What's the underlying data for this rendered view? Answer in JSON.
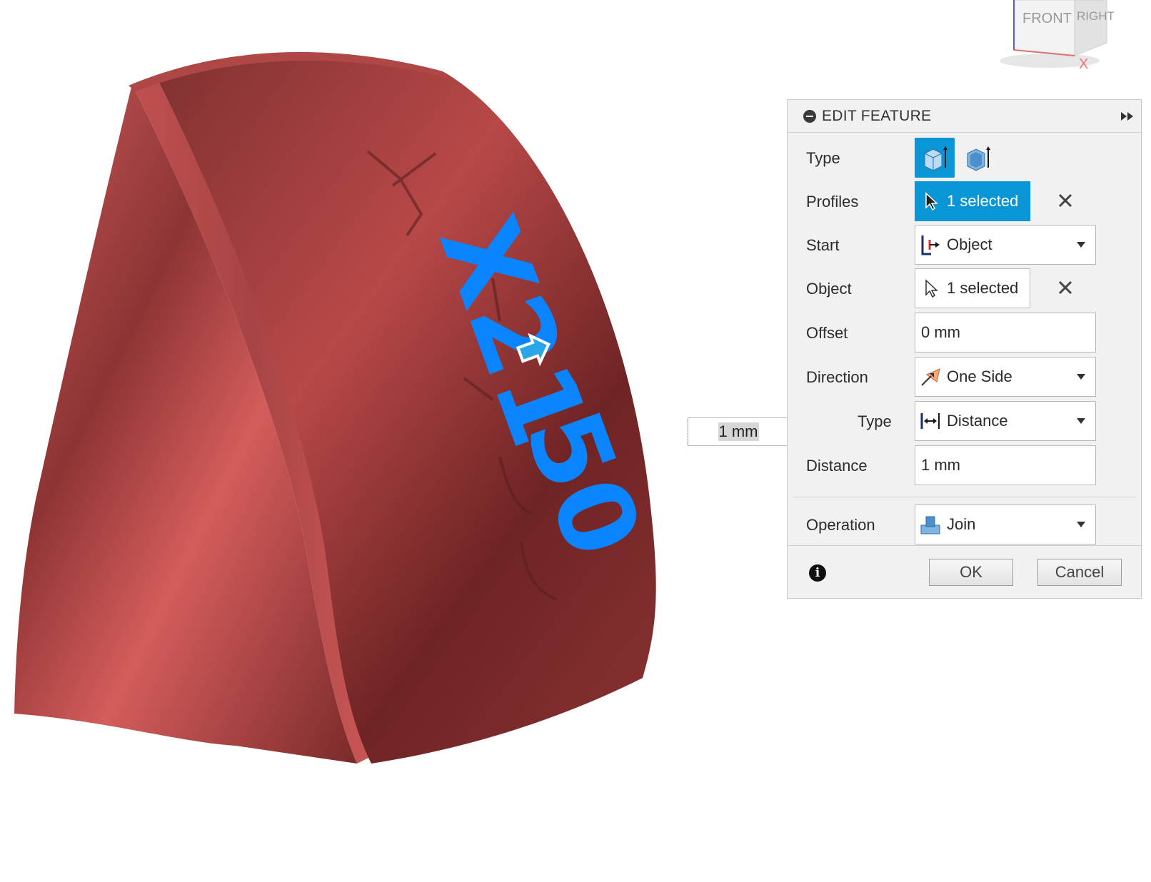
{
  "view_cube": {
    "front": "FRONT",
    "right": "RIGHT",
    "axis": "X"
  },
  "model_text": "X21 50",
  "inline_input": {
    "value": "1 mm"
  },
  "dialog": {
    "title": "EDIT FEATURE",
    "rows": {
      "type": {
        "label": "Type"
      },
      "profiles": {
        "label": "Profiles",
        "value": "1 selected"
      },
      "start": {
        "label": "Start",
        "value": "Object"
      },
      "object": {
        "label": "Object",
        "value": "1 selected"
      },
      "offset": {
        "label": "Offset",
        "value": "0 mm"
      },
      "direction": {
        "label": "Direction",
        "value": "One Side"
      },
      "extent_type": {
        "label": "Type",
        "value": "Distance"
      },
      "distance": {
        "label": "Distance",
        "value": "1 mm"
      },
      "operation": {
        "label": "Operation",
        "value": "Join"
      }
    },
    "buttons": {
      "ok": "OK",
      "cancel": "Cancel"
    }
  },
  "colors": {
    "accent": "#0a96d6",
    "model": "#b5484a",
    "text_blue": "#0a84ff"
  },
  "icons": [
    "collapse-icon",
    "expand-arrows-icon",
    "extrude-solid-icon",
    "extrude-thin-icon",
    "select-cursor-icon",
    "clear-x-icon",
    "start-object-icon",
    "direction-icon",
    "distance-icon",
    "join-icon",
    "info-icon",
    "grip-dots-icon",
    "move-cursor-icon"
  ]
}
